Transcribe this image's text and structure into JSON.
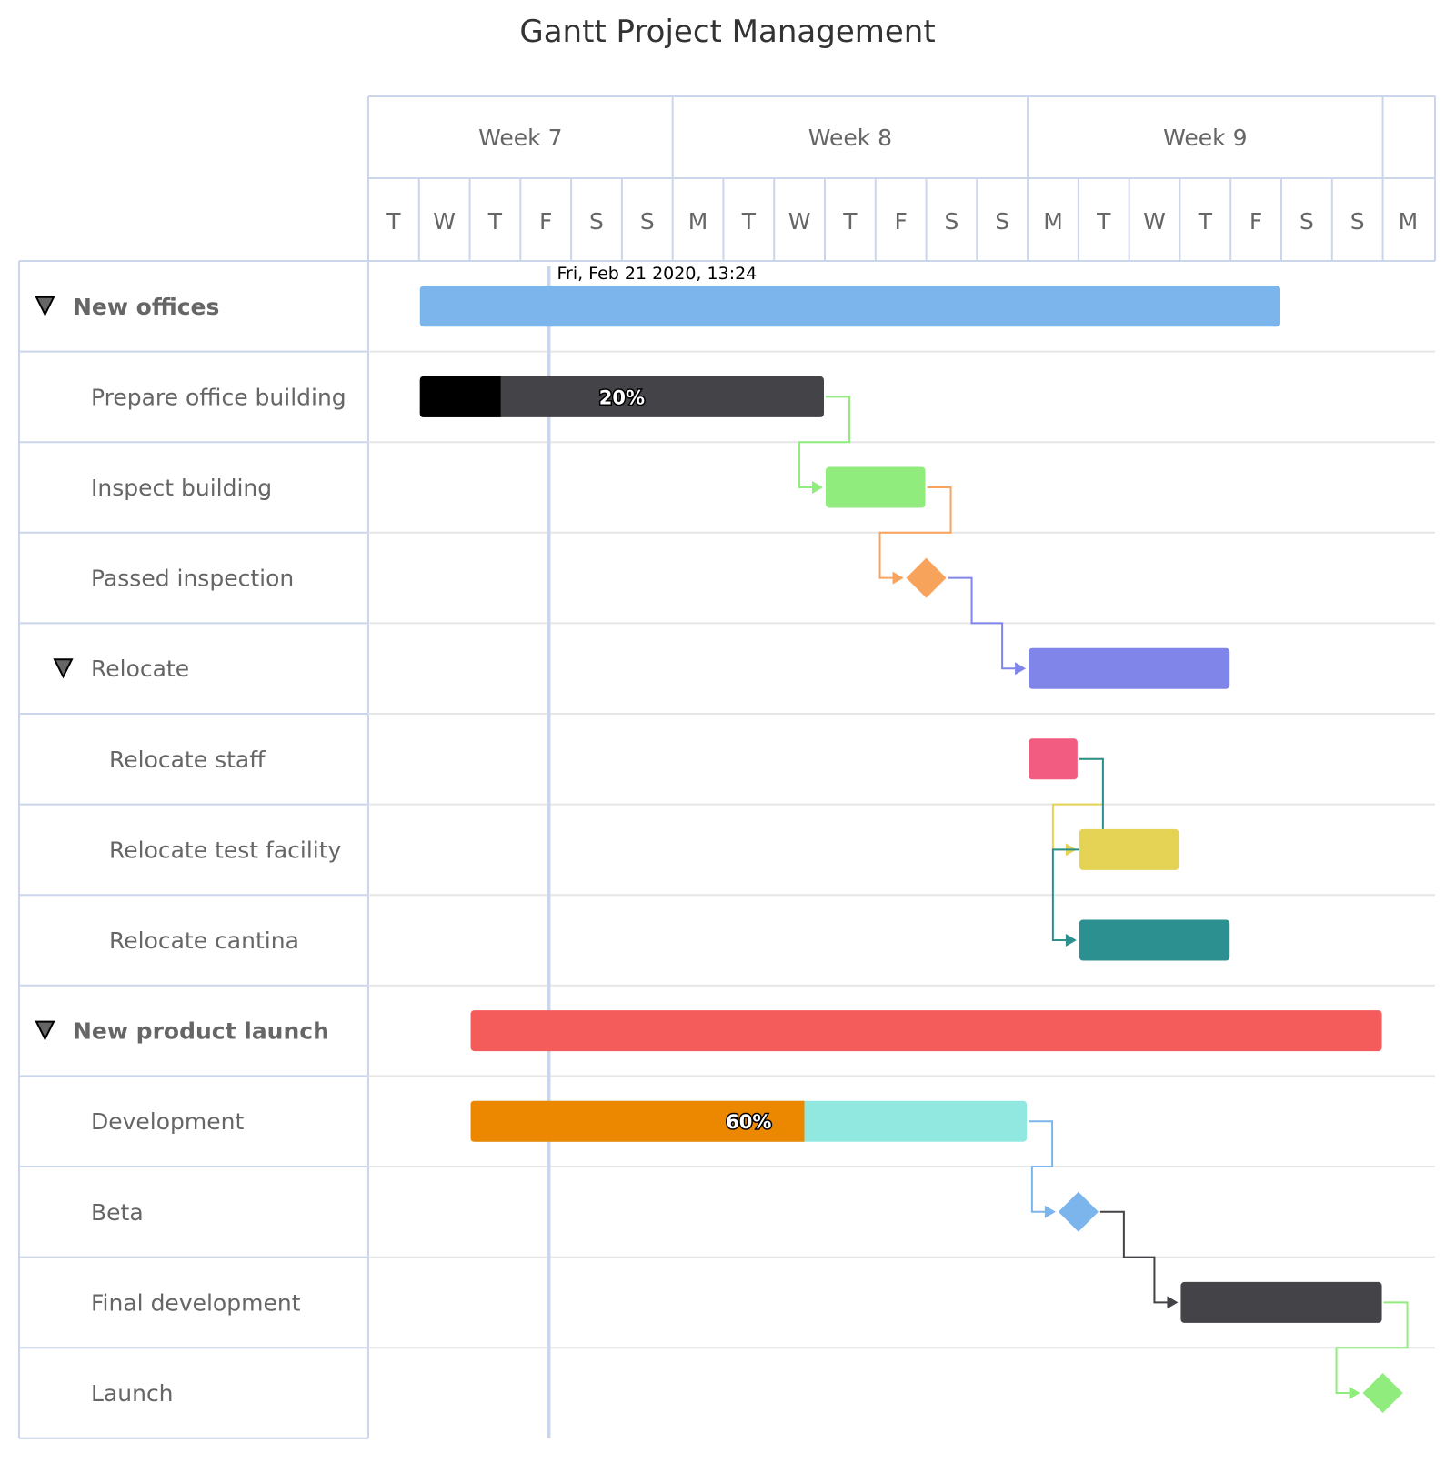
{
  "title": "Gantt Project Management",
  "current_time_label": "Fri, Feb 21 2020, 13:24",
  "colors": {
    "grid": "#ccd6eb",
    "row_line": "#e6e6e6",
    "now_line": "#ccd6eb",
    "label": "#666666",
    "title": "#333333"
  },
  "chart_data": {
    "type": "gantt",
    "title": "Gantt Project Management",
    "x_axis": {
      "unit": "day",
      "range": [
        "2020-02-18",
        "2020-03-09"
      ],
      "weeks": [
        {
          "label": "Week 7",
          "start": "2020-02-18",
          "end": "2020-02-24"
        },
        {
          "label": "Week 8",
          "start": "2020-02-24",
          "end": "2020-03-02"
        },
        {
          "label": "Week 9",
          "start": "2020-03-02",
          "end": "2020-03-09"
        },
        {
          "label": "",
          "start": "2020-03-09",
          "end": "2020-03-10"
        }
      ],
      "days": [
        {
          "label": "T",
          "date": "2020-02-18"
        },
        {
          "label": "W",
          "date": "2020-02-19"
        },
        {
          "label": "T",
          "date": "2020-02-20"
        },
        {
          "label": "F",
          "date": "2020-02-21"
        },
        {
          "label": "S",
          "date": "2020-02-22"
        },
        {
          "label": "S",
          "date": "2020-02-23"
        },
        {
          "label": "M",
          "date": "2020-02-24"
        },
        {
          "label": "T",
          "date": "2020-02-25"
        },
        {
          "label": "W",
          "date": "2020-02-26"
        },
        {
          "label": "T",
          "date": "2020-02-27"
        },
        {
          "label": "F",
          "date": "2020-02-28"
        },
        {
          "label": "S",
          "date": "2020-02-29"
        },
        {
          "label": "S",
          "date": "2020-03-01"
        },
        {
          "label": "M",
          "date": "2020-03-02"
        },
        {
          "label": "T",
          "date": "2020-03-03"
        },
        {
          "label": "W",
          "date": "2020-03-04"
        },
        {
          "label": "T",
          "date": "2020-03-05"
        },
        {
          "label": "F",
          "date": "2020-03-06"
        },
        {
          "label": "S",
          "date": "2020-03-07"
        },
        {
          "label": "S",
          "date": "2020-03-08"
        },
        {
          "label": "M",
          "date": "2020-03-09"
        }
      ]
    },
    "current_time": "2020-02-21T13:24",
    "tasks": [
      {
        "id": "new_offices",
        "name": "New offices",
        "level": 0,
        "collapsible": true,
        "bold": true,
        "start": "2020-02-19",
        "end": "2020-03-07",
        "color": "#7cb5ec"
      },
      {
        "id": "prepare_building",
        "name": "Prepare office building",
        "level": 1,
        "start": "2020-02-19",
        "end": "2020-02-27",
        "color": "#434348",
        "completed": 0.2,
        "completed_color": "#000000",
        "label": "20%"
      },
      {
        "id": "inspect_building",
        "name": "Inspect building",
        "level": 1,
        "start": "2020-02-27",
        "end": "2020-02-29",
        "color": "#90ed7d",
        "dependency": "prepare_building"
      },
      {
        "id": "passed_inspection",
        "name": "Passed inspection",
        "level": 1,
        "milestone": true,
        "start": "2020-02-29",
        "color": "#f7a35c",
        "dependency": "inspect_building"
      },
      {
        "id": "relocate",
        "name": "Relocate",
        "level": 1,
        "collapsible": true,
        "start": "2020-03-02",
        "end": "2020-03-06",
        "color": "#8085e9",
        "dependency": "passed_inspection"
      },
      {
        "id": "relocate_staff",
        "name": "Relocate staff",
        "level": 2,
        "start": "2020-03-02",
        "end": "2020-03-03",
        "color": "#f15c80"
      },
      {
        "id": "relocate_test",
        "name": "Relocate test facility",
        "level": 2,
        "start": "2020-03-03",
        "end": "2020-03-05",
        "color": "#e4d354",
        "dependency": "relocate_staff"
      },
      {
        "id": "relocate_cantina",
        "name": "Relocate cantina",
        "level": 2,
        "start": "2020-03-03",
        "end": "2020-03-06",
        "color": "#2b908f",
        "dependency": "relocate_test"
      },
      {
        "id": "new_product",
        "name": "New product launch",
        "level": 0,
        "collapsible": true,
        "bold": true,
        "start": "2020-02-20",
        "end": "2020-03-09",
        "color": "#f45b5b"
      },
      {
        "id": "development",
        "name": "Development",
        "level": 1,
        "start": "2020-02-20",
        "end": "2020-03-02",
        "color": "#91e8e1",
        "completed": 0.6,
        "completed_color": "#ec8800",
        "label": "60%"
      },
      {
        "id": "beta",
        "name": "Beta",
        "level": 1,
        "milestone": true,
        "start": "2020-03-03",
        "color": "#7cb5ec",
        "dependency": "development"
      },
      {
        "id": "final_development",
        "name": "Final development",
        "level": 1,
        "start": "2020-03-05",
        "end": "2020-03-09",
        "color": "#434348",
        "dependency": "beta"
      },
      {
        "id": "launch",
        "name": "Launch",
        "level": 1,
        "milestone": true,
        "start": "2020-03-09",
        "color": "#90ed7d",
        "dependency": "final_development"
      }
    ],
    "dependency_links": [
      {
        "from": "prepare_building",
        "to": "inspect_building",
        "color": "#90ed7d"
      },
      {
        "from": "inspect_building",
        "to": "passed_inspection",
        "color": "#f7a35c"
      },
      {
        "from": "passed_inspection",
        "to": "relocate",
        "color": "#8085e9"
      },
      {
        "from": "relocate_staff",
        "to": "relocate_test",
        "color": "#e4d354"
      },
      {
        "from": "relocate_staff",
        "to": "relocate_cantina",
        "color": "#2b908f"
      },
      {
        "from": "development",
        "to": "beta",
        "color": "#7cb5ec"
      },
      {
        "from": "beta",
        "to": "final_development",
        "color": "#434348"
      },
      {
        "from": "final_development",
        "to": "launch",
        "color": "#90ed7d"
      }
    ]
  }
}
